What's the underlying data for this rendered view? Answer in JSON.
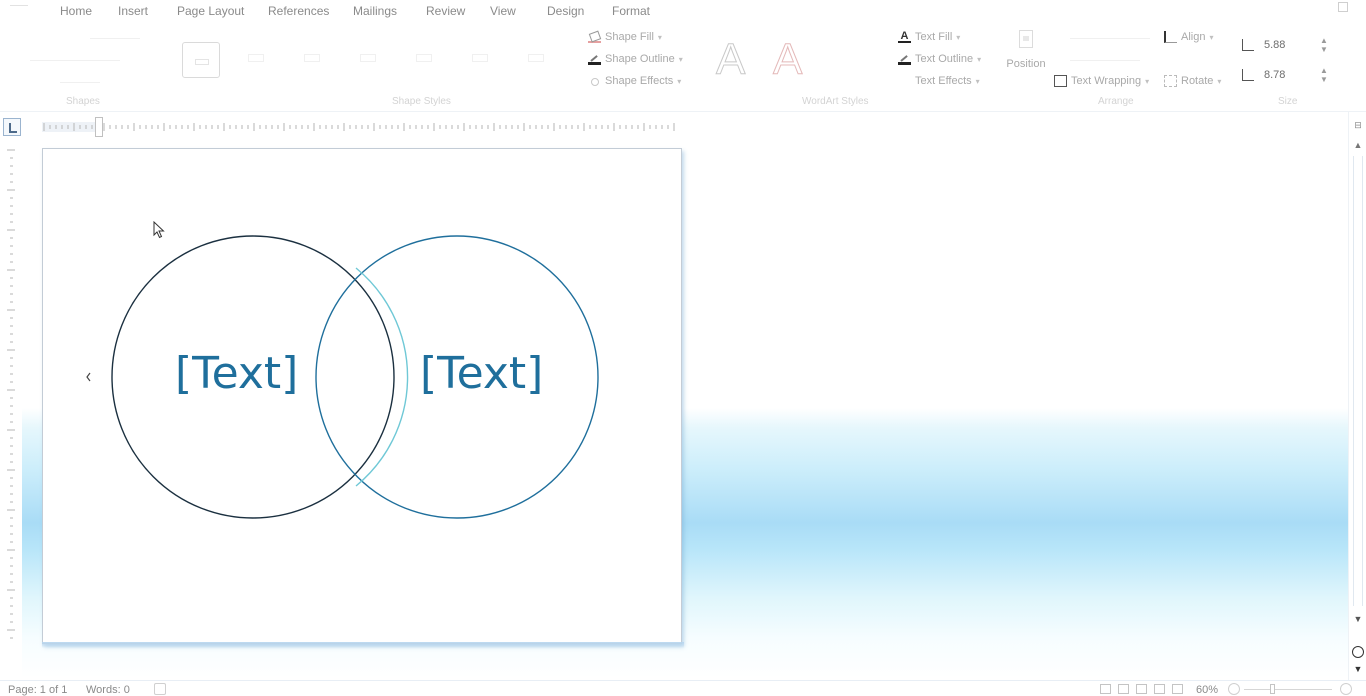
{
  "ribbon": {
    "tabs": [
      "Home",
      "Insert",
      "Page Layout",
      "References",
      "Mailings",
      "Review",
      "View",
      "Design",
      "Format"
    ],
    "groups": [
      "Shapes",
      "Shape Styles",
      "WordArt Styles",
      "Arrange",
      "Size"
    ],
    "shape_styles": {
      "fill": "Shape Fill",
      "outline": "Shape Outline",
      "effects": "Shape Effects"
    },
    "wordart": {
      "sample_a": "A",
      "sample_b": "A",
      "text_fill": "Text Fill",
      "text_outline": "Text Outline",
      "text_effects": "Text Effects"
    },
    "arrange": {
      "position": "Position",
      "text_wrapping": "Text Wrapping",
      "align": "Align",
      "rotate": "Rotate"
    },
    "size": {
      "height": "5.88",
      "width": "8.78"
    }
  },
  "venn": {
    "left_label": "[Text]",
    "right_label": "[Text]",
    "circle_color": "#1f6f9c"
  },
  "status_bar": {
    "page": "Page: 1 of 1",
    "words": "Words: 0",
    "zoom": "60%"
  },
  "icons": [
    "shape-fill-icon",
    "shape-outline-icon",
    "shape-effects-icon",
    "text-fill-icon",
    "text-outline-icon",
    "text-effects-icon",
    "position-icon",
    "text-wrapping-icon",
    "align-icon",
    "rotate-icon",
    "height-icon",
    "width-icon",
    "mouse-pointer-icon"
  ]
}
